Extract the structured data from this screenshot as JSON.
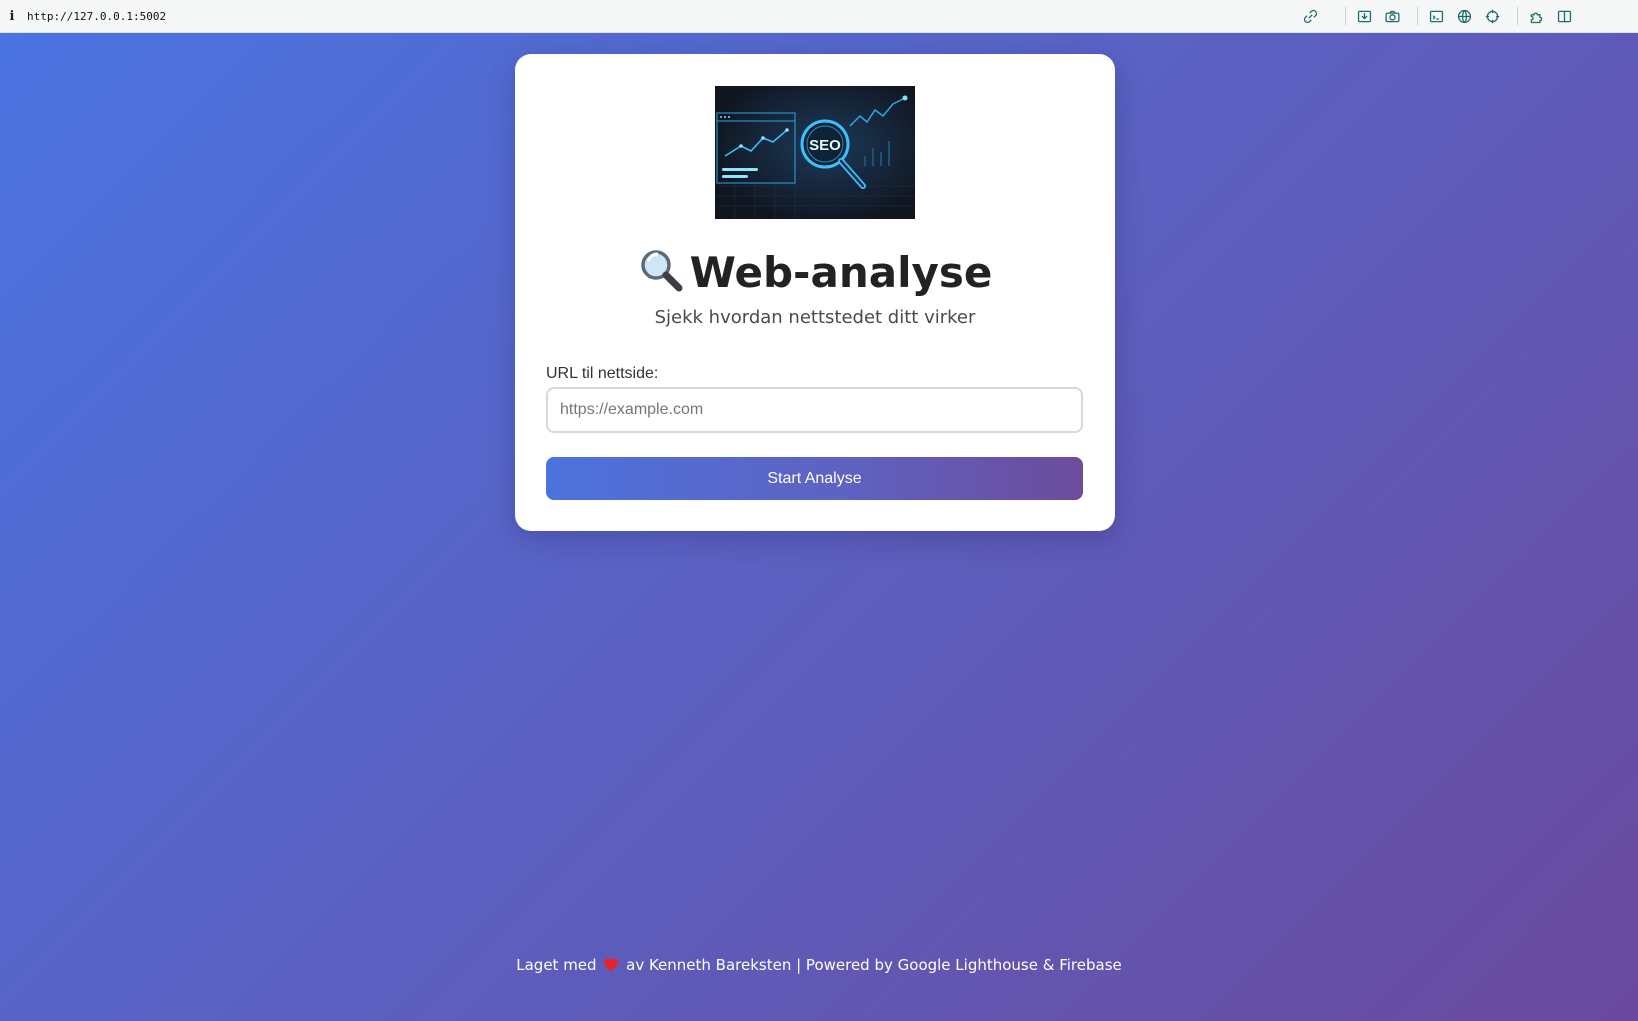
{
  "browser": {
    "url": "http://127.0.0.1:5002",
    "info_icon": "i",
    "toolbar_icons": [
      "link-icon",
      "download-icon",
      "camera-icon",
      "terminal-icon",
      "globe-icon",
      "crosshair-icon",
      "extension-icon",
      "sidebar-icon"
    ]
  },
  "hero": {
    "image": "seo-analytics-illustration",
    "seo_text": "SEO"
  },
  "main": {
    "title_icon": "magnifying-glass-icon",
    "title": "Web-analyse",
    "subtitle": "Sjekk hvordan nettstedet ditt virker"
  },
  "form": {
    "url_label": "URL til nettside:",
    "url_placeholder": "https://example.com",
    "url_value": "",
    "submit_label": "Start Analyse"
  },
  "footer": {
    "text_before": "Laget med",
    "heart_icon": "heart-icon",
    "text_after": "av Kenneth Bareksten | Powered by Google Lighthouse & Firebase"
  },
  "colors": {
    "bg_start": "#4a74e2",
    "bg_end": "#6a4a9e",
    "card": "#ffffff",
    "button_start": "#4c73dd",
    "button_end": "#6d4c9c",
    "toolbar_icon": "#1a6b6b"
  }
}
